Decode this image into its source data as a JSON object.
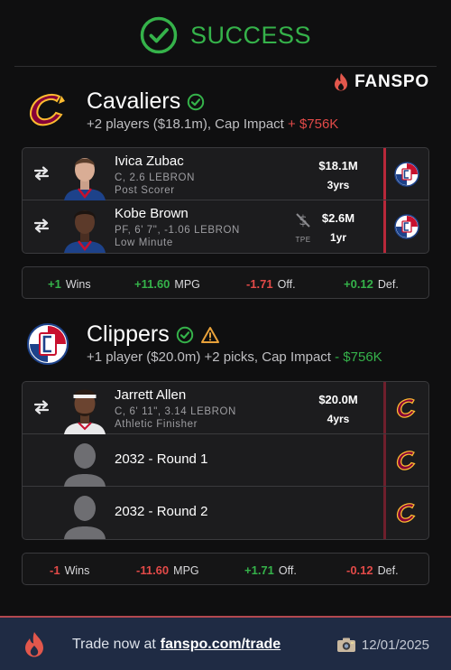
{
  "header": {
    "status": "SUCCESS",
    "brand": "FANSPO"
  },
  "colors": {
    "success": "#35b24a",
    "negative": "#e24a48",
    "cavs_wine": "#860038",
    "cavs_gold": "#FDBB30",
    "clippers_red": "#C8102E",
    "clippers_blue": "#1D428A"
  },
  "teams": [
    {
      "name": "Cavaliers",
      "summary_prefix": "+2 players ($18.1m), Cap Impact ",
      "cap_impact": "+ $756K",
      "players": [
        {
          "name": "Ivica Zubac",
          "detail": "C, 2.6 LEBRON",
          "role": "Post Scorer",
          "salary": "$18.1M",
          "years": "3yrs",
          "incoming_from": "clippers-logo-icon"
        },
        {
          "name": "Kobe Brown",
          "detail": "PF, 6' 7\", -1.06 LEBRON",
          "role": "Low Minute",
          "salary": "$2.6M",
          "years": "1yr",
          "tpe_label": "TPE",
          "incoming_from": "clippers-logo-icon"
        }
      ],
      "stats": {
        "wins": "+1",
        "wins_label": "Wins",
        "mpg": "+11.60",
        "mpg_label": "MPG",
        "off": "-1.71",
        "off_label": "Off.",
        "def": "+0.12",
        "def_label": "Def."
      }
    },
    {
      "name": "Clippers",
      "summary_prefix": "+1 player ($20.0m) +2 picks, Cap Impact ",
      "cap_impact": "- $756K",
      "players": [
        {
          "name": "Jarrett Allen",
          "detail": "C, 6' 11\", 3.14 LEBRON",
          "role": "Athletic Finisher",
          "salary": "$20.0M",
          "years": "4yrs",
          "incoming_from": "cavaliers-logo-icon"
        },
        {
          "name": "2032 - Round 1",
          "incoming_from": "cavaliers-logo-icon"
        },
        {
          "name": "2032 - Round 2",
          "incoming_from": "cavaliers-logo-icon"
        }
      ],
      "stats": {
        "wins": "-1",
        "wins_label": "Wins",
        "mpg": "-11.60",
        "mpg_label": "MPG",
        "off": "+1.71",
        "off_label": "Off.",
        "def": "-0.12",
        "def_label": "Def."
      }
    }
  ],
  "footer": {
    "cta": "Trade now at",
    "link": "fanspo.com/trade",
    "date": "12/01/2025"
  }
}
